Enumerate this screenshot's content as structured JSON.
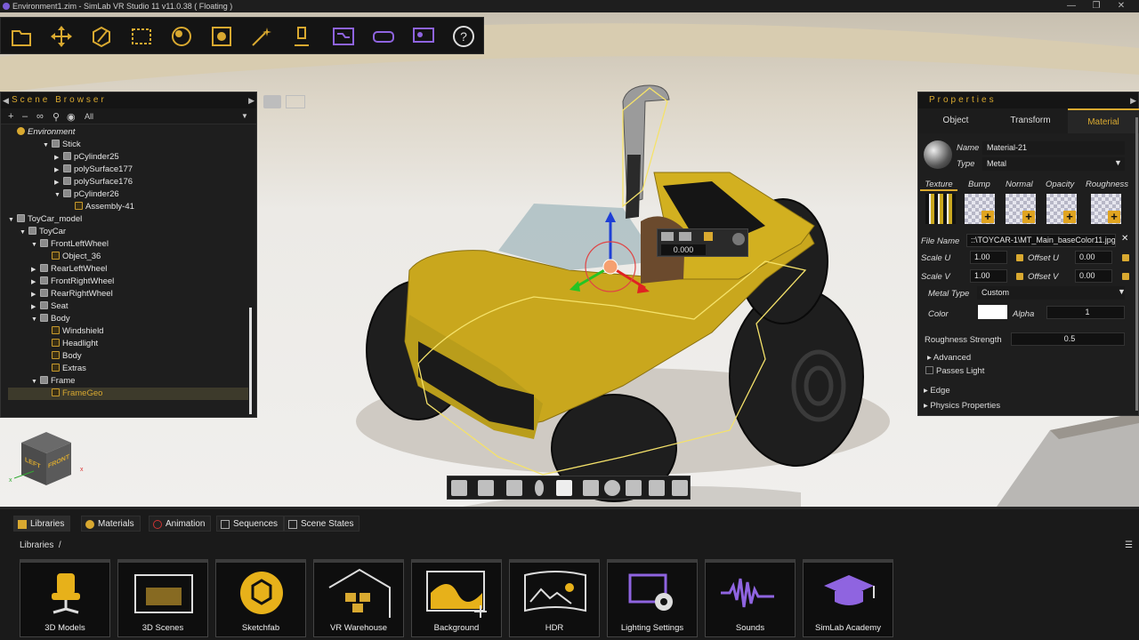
{
  "window": {
    "title": "Environment1.zim - SimLab VR Studio 11 v11.0.38 ( Floating )"
  },
  "toolbar": {
    "icons": [
      "folder-icon",
      "move-icon",
      "edit-icon",
      "select-box-icon",
      "material-icon",
      "texture-icon",
      "effects-icon",
      "light-icon",
      "workflow-icon",
      "vr-headset-icon",
      "presentation-icon",
      "help-icon"
    ]
  },
  "scene_browser": {
    "title": "Scene Browser",
    "filter": "All",
    "tree": [
      {
        "label": "Environment",
        "depth": 0,
        "expand": "",
        "icon": "sun"
      },
      {
        "label": "Stick",
        "depth": 3,
        "expand": "▼",
        "icon": "grp"
      },
      {
        "label": "pCylinder25",
        "depth": 4,
        "expand": "▶",
        "icon": "grp"
      },
      {
        "label": "polySurface177",
        "depth": 4,
        "expand": "▶",
        "icon": "grp"
      },
      {
        "label": "polySurface176",
        "depth": 4,
        "expand": "▶",
        "icon": "grp"
      },
      {
        "label": "pCylinder26",
        "depth": 4,
        "expand": "▼",
        "icon": "grp"
      },
      {
        "label": "Assembly-41",
        "depth": 5,
        "expand": "",
        "icon": "cube"
      },
      {
        "label": "ToyCar_model",
        "depth": 0,
        "expand": "▼",
        "icon": "grp"
      },
      {
        "label": "ToyCar",
        "depth": 1,
        "expand": "▼",
        "icon": "grp"
      },
      {
        "label": "FrontLeftWheel",
        "depth": 2,
        "expand": "▼",
        "icon": "grp"
      },
      {
        "label": "Object_36",
        "depth": 3,
        "expand": "",
        "icon": "cube"
      },
      {
        "label": "RearLeftWheel",
        "depth": 2,
        "expand": "▶",
        "icon": "grp"
      },
      {
        "label": "FrontRightWheel",
        "depth": 2,
        "expand": "▶",
        "icon": "grp"
      },
      {
        "label": "RearRightWheel",
        "depth": 2,
        "expand": "▶",
        "icon": "grp"
      },
      {
        "label": "Seat",
        "depth": 2,
        "expand": "▶",
        "icon": "grp"
      },
      {
        "label": "Body",
        "depth": 2,
        "expand": "▼",
        "icon": "grp"
      },
      {
        "label": "Windshield",
        "depth": 3,
        "expand": "",
        "icon": "cube"
      },
      {
        "label": "Headlight",
        "depth": 3,
        "expand": "",
        "icon": "cube"
      },
      {
        "label": "Body",
        "depth": 3,
        "expand": "",
        "icon": "cube"
      },
      {
        "label": "Extras",
        "depth": 3,
        "expand": "",
        "icon": "cube"
      },
      {
        "label": "Frame",
        "depth": 2,
        "expand": "▼",
        "icon": "grp"
      },
      {
        "label": "FrameGeo",
        "depth": 3,
        "expand": "",
        "icon": "cube",
        "selected": true
      }
    ]
  },
  "viewcube": {
    "left": "LEFT",
    "front": "FRONT"
  },
  "gizmo": {
    "value": "0.000"
  },
  "properties": {
    "title": "Properties",
    "tabs": [
      "Object",
      "Transform",
      "Material"
    ],
    "active_tab": "Material",
    "name_label": "Name",
    "name_value": "Material-21",
    "type_label": "Type",
    "type_value": "Metal",
    "maps": [
      "Texture",
      "Bump",
      "Normal",
      "Opacity",
      "Roughness"
    ],
    "file_label": "File Name",
    "file_value": "::\\TOYCAR-1\\MT_Main_baseColor11.jpg",
    "scale_u_label": "Scale U",
    "scale_u": "1.00",
    "offset_u_label": "Offset U",
    "offset_u": "0.00",
    "scale_v_label": "Scale V",
    "scale_v": "1.00",
    "offset_v_label": "Offset V",
    "offset_v": "0.00",
    "metal_type_label": "Metal Type",
    "metal_type": "Custom",
    "color_label": "Color",
    "color_value": "#ffffff",
    "alpha_label": "Alpha",
    "alpha": "1",
    "rough_label": "Roughness Strength",
    "rough": "0.5",
    "advanced": "Advanced",
    "passes_light": "Passes Light",
    "edge": "Edge",
    "physics": "Physics Properties"
  },
  "bottom": {
    "tabs": [
      "Libraries",
      "Materials",
      "Animation",
      "Sequences",
      "Scene States"
    ],
    "breadcrumb": "Libraries",
    "cards": [
      "3D Models",
      "3D Scenes",
      "Sketchfab",
      "VR Warehouse",
      "Background",
      "HDR",
      "Lighting Settings",
      "Sounds",
      "SimLab Academy"
    ]
  },
  "colors": {
    "accent": "#d9a930",
    "purple": "#8f64e0"
  }
}
